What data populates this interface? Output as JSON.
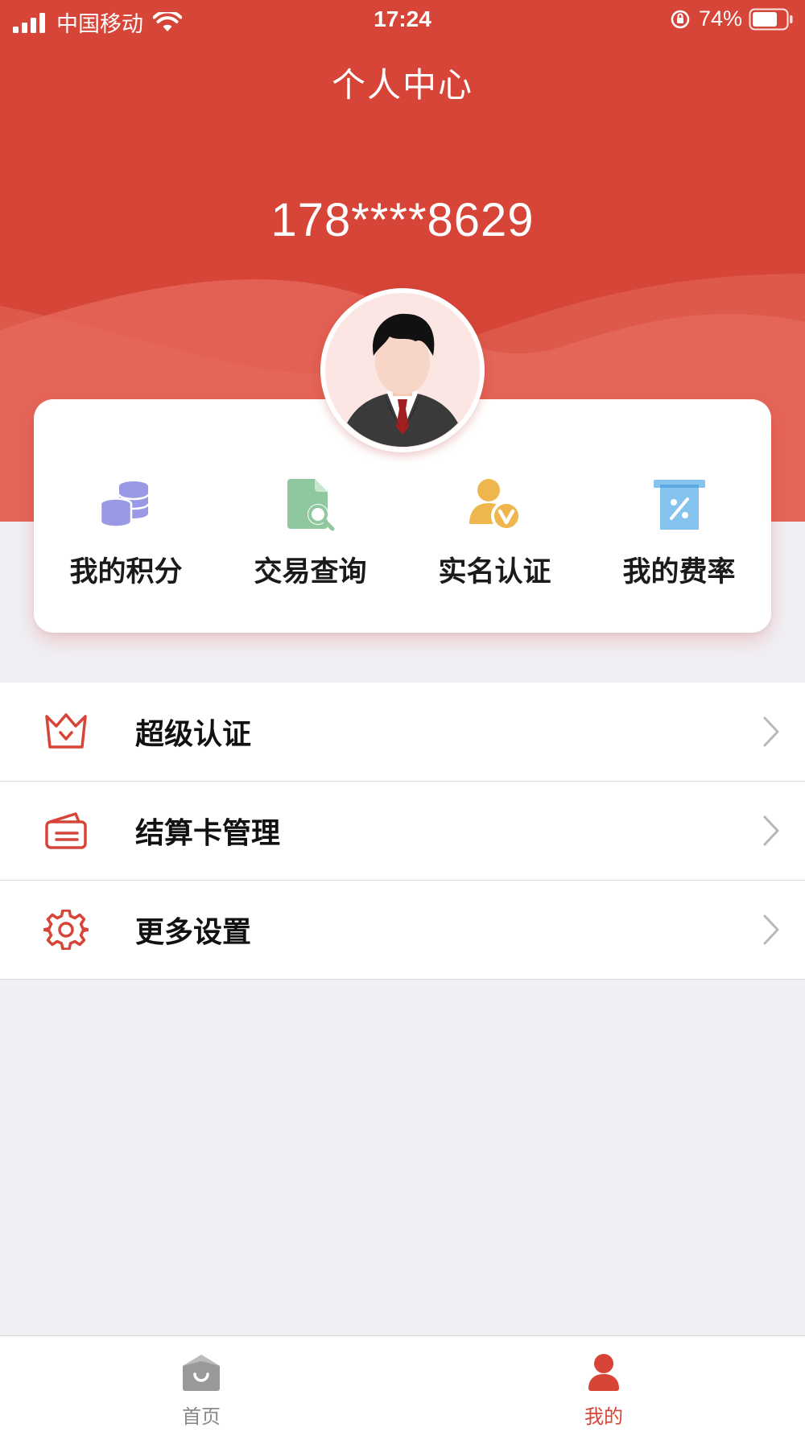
{
  "status_bar": {
    "carrier": "中国移动",
    "time": "17:24",
    "battery": "74%"
  },
  "header": {
    "title": "个人中心",
    "phone": "178****8629"
  },
  "colors": {
    "brand": "#d64538",
    "quick_points": "#9a99e6",
    "quick_query": "#8fc79f",
    "quick_verify": "#f0b64e",
    "quick_rate": "#86c4f0"
  },
  "quick_actions": [
    {
      "label": "我的积分",
      "icon": "coins-icon"
    },
    {
      "label": "交易查询",
      "icon": "document-search-icon"
    },
    {
      "label": "实名认证",
      "icon": "user-verified-icon"
    },
    {
      "label": "我的费率",
      "icon": "rate-receipt-icon"
    }
  ],
  "menu": [
    {
      "label": "超级认证",
      "icon": "crown-icon"
    },
    {
      "label": "结算卡管理",
      "icon": "card-icon"
    },
    {
      "label": "更多设置",
      "icon": "gear-icon"
    }
  ],
  "tabbar": {
    "home": {
      "label": "首页",
      "active": false
    },
    "mine": {
      "label": "我的",
      "active": true
    }
  }
}
